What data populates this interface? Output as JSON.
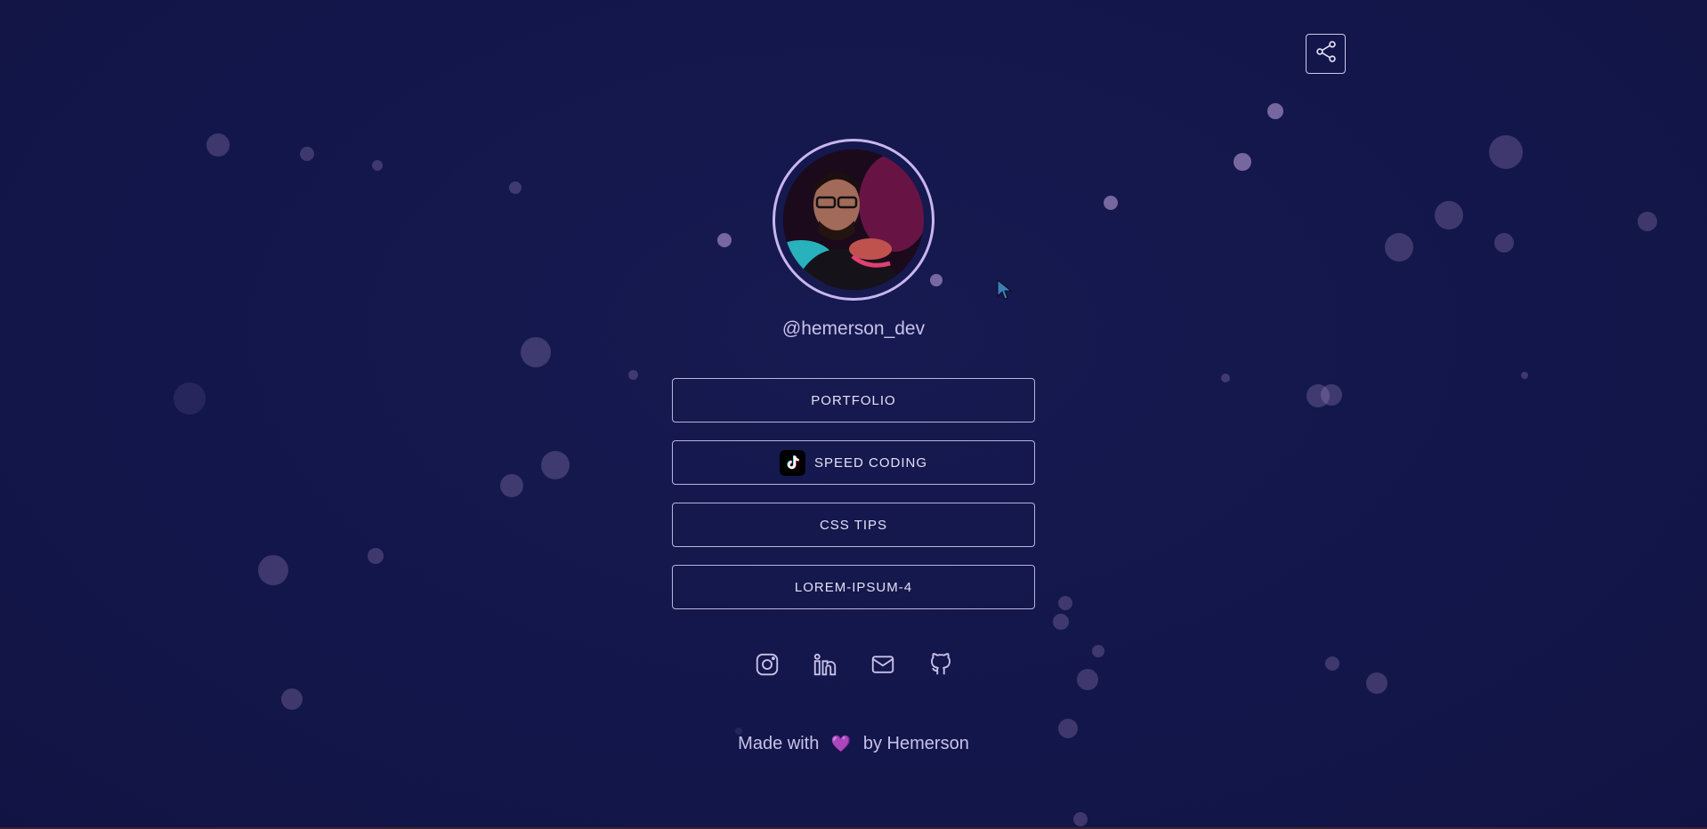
{
  "profile": {
    "handle": "@hemerson_dev"
  },
  "links": [
    {
      "label": "PORTFOLIO",
      "icon": null
    },
    {
      "label": "SPEED CODING",
      "icon": "tiktok-icon"
    },
    {
      "label": "CSS TIPS",
      "icon": null
    },
    {
      "label": "LOREM-IPSUM-4",
      "icon": null
    }
  ],
  "socials": [
    {
      "name": "instagram-icon"
    },
    {
      "name": "linkedin-icon"
    },
    {
      "name": "mail-icon"
    },
    {
      "name": "github-icon"
    }
  ],
  "footer": {
    "prefix": "Made with",
    "heart": "💜",
    "suffix": "by Hemerson"
  },
  "colors": {
    "background": "#14174a",
    "accent": "#c9b6ee",
    "text": "#c9c2ea",
    "heart": "#9a5bd9"
  }
}
